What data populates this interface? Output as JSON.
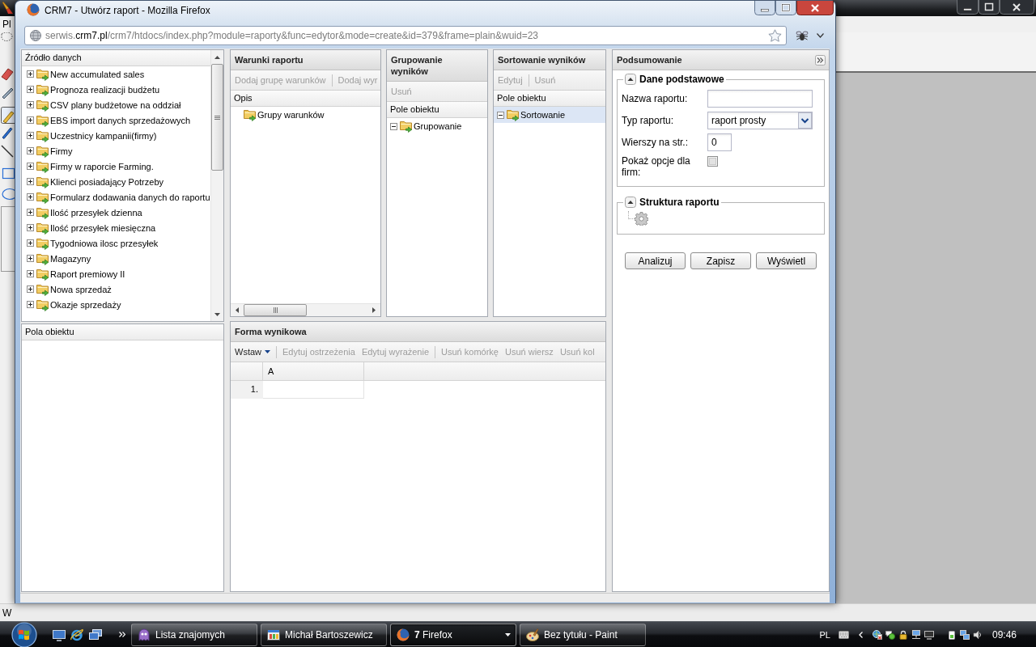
{
  "background_window": {
    "menu_label": "Pl",
    "status_label": "W"
  },
  "window": {
    "title": "CRM7 - Utwórz raport - Mozilla Firefox"
  },
  "address_bar": {
    "url_parts": [
      {
        "text": "serwis.",
        "highlighted": false
      },
      {
        "text": "crm7.pl",
        "highlighted": true
      },
      {
        "text": "/crm7/htdocs/index.php?module=raporty&func=edytor&mode=create&id=379&frame=plain&wuid=23",
        "highlighted": false
      }
    ]
  },
  "data_source": {
    "title": "Źródło danych",
    "items": [
      {
        "label": "New accumulated sales",
        "expanded": false,
        "selected": false
      },
      {
        "label": "Prognoza realizacji budżetu",
        "expanded": false,
        "selected": false
      },
      {
        "label": "CSV plany budżetowe na oddział",
        "expanded": false,
        "selected": false
      },
      {
        "label": "EBS import danych sprzedażowych",
        "expanded": false,
        "selected": false
      },
      {
        "label": "Uczestnicy kampanii(firmy)",
        "expanded": false,
        "selected": false
      },
      {
        "label": "Firmy",
        "expanded": false,
        "selected": false
      },
      {
        "label": "Firmy w raporcie Farming.",
        "expanded": false,
        "selected": false
      },
      {
        "label": "Klienci posiadający Potrzeby",
        "expanded": false,
        "selected": false
      },
      {
        "label": "Formularz dodawania danych do raportu",
        "expanded": false,
        "selected": false
      },
      {
        "label": "Ilość przesyłek dzienna",
        "expanded": false,
        "selected": false
      },
      {
        "label": "Ilość przesyłek miesięczna",
        "expanded": false,
        "selected": false
      },
      {
        "label": "Tygodniowa ilosc przesyłek",
        "expanded": false,
        "selected": false
      },
      {
        "label": "Magazyny",
        "expanded": false,
        "selected": false
      },
      {
        "label": "Raport premiowy II",
        "expanded": false,
        "selected": false
      },
      {
        "label": "Nowa sprzedaż",
        "expanded": false,
        "selected": false
      },
      {
        "label": "Okazje sprzedaży",
        "expanded": false,
        "selected": false
      }
    ]
  },
  "object_fields": {
    "title": "Pola obiektu"
  },
  "conditions": {
    "title": "Warunki raportu",
    "toolbar": [
      {
        "buttons": [
          {
            "label": "Dodaj grupę warunków",
            "kind": "plain",
            "disabled": true
          }
        ]
      },
      {
        "buttons": [
          {
            "label": "Dodaj wyr",
            "kind": "plain",
            "disabled": true
          }
        ]
      }
    ],
    "column": "Opis",
    "items": [
      {
        "label": "Grupy warunków",
        "selected": false
      }
    ]
  },
  "grouping": {
    "title": "Grupowanie wyników",
    "toolbar": [
      {
        "buttons": [
          {
            "label": "Usuń",
            "kind": "plain",
            "disabled": true
          }
        ]
      }
    ],
    "column": "Pole obiektu",
    "items": [
      {
        "label": "Grupowanie",
        "expanded": true,
        "selected": false
      }
    ]
  },
  "sorting": {
    "title": "Sortowanie wyników",
    "toolbar": [
      {
        "buttons": [
          {
            "label": "Edytuj",
            "kind": "plain",
            "disabled": true
          }
        ]
      },
      {
        "buttons": [
          {
            "label": "Usuń",
            "kind": "plain",
            "disabled": true
          }
        ]
      }
    ],
    "column": "Pole obiektu",
    "items": [
      {
        "label": "Sortowanie",
        "expanded": true,
        "selected": true
      }
    ]
  },
  "result_form": {
    "title": "Forma wynikowa",
    "toolbar": [
      {
        "buttons": [
          {
            "label": "Wstaw",
            "kind": "menu",
            "disabled": false
          }
        ]
      },
      {
        "buttons": [
          {
            "label": "Edytuj ostrzeżenia",
            "kind": "plain",
            "disabled": true
          },
          {
            "label": "Edytuj wyrażenie",
            "kind": "plain",
            "disabled": true
          }
        ]
      },
      {
        "buttons": [
          {
            "label": "Usuń komórkę",
            "kind": "plain",
            "disabled": true
          },
          {
            "label": "Usuń wiersz",
            "kind": "plain",
            "disabled": true
          },
          {
            "label": "Usuń kol",
            "kind": "plain",
            "disabled": true
          }
        ]
      }
    ],
    "grid": {
      "columns": [
        "A"
      ],
      "rows": [
        {
          "number": "1."
        }
      ]
    }
  },
  "summary": {
    "title": "Podsumowanie",
    "sections": [
      {
        "title": "Dane podstawowe",
        "kind": "form",
        "expanded": true,
        "fields": [
          {
            "kind": "text",
            "label": "Nazwa raportu:"
          },
          {
            "kind": "select",
            "label": "Typ raportu:",
            "value": "raport prosty"
          },
          {
            "kind": "number",
            "label": "Wierszy na str.:",
            "value": "0"
          },
          {
            "kind": "checkbox",
            "label": "Pokaż opcje dla firm:",
            "checked": false
          }
        ]
      },
      {
        "title": "Struktura raportu",
        "kind": "structure",
        "expanded": true
      }
    ],
    "buttons": [
      "Analizuj",
      "Zapisz",
      "Wyświetl"
    ]
  },
  "taskbar": {
    "tasks": [
      {
        "label": "Lista znajomych",
        "kind": "messenger",
        "grouped": false,
        "selected": false
      },
      {
        "label": "Michał Bartoszewicz",
        "kind": "chat",
        "grouped": false,
        "selected": false
      },
      {
        "label": "**7** Firefox",
        "kind": "browser",
        "grouped": true,
        "selected": true
      },
      {
        "label": "Bez tytułu - Paint",
        "kind": "paint",
        "grouped": false,
        "selected": false
      }
    ],
    "language": "PL",
    "clock": "09:46"
  }
}
